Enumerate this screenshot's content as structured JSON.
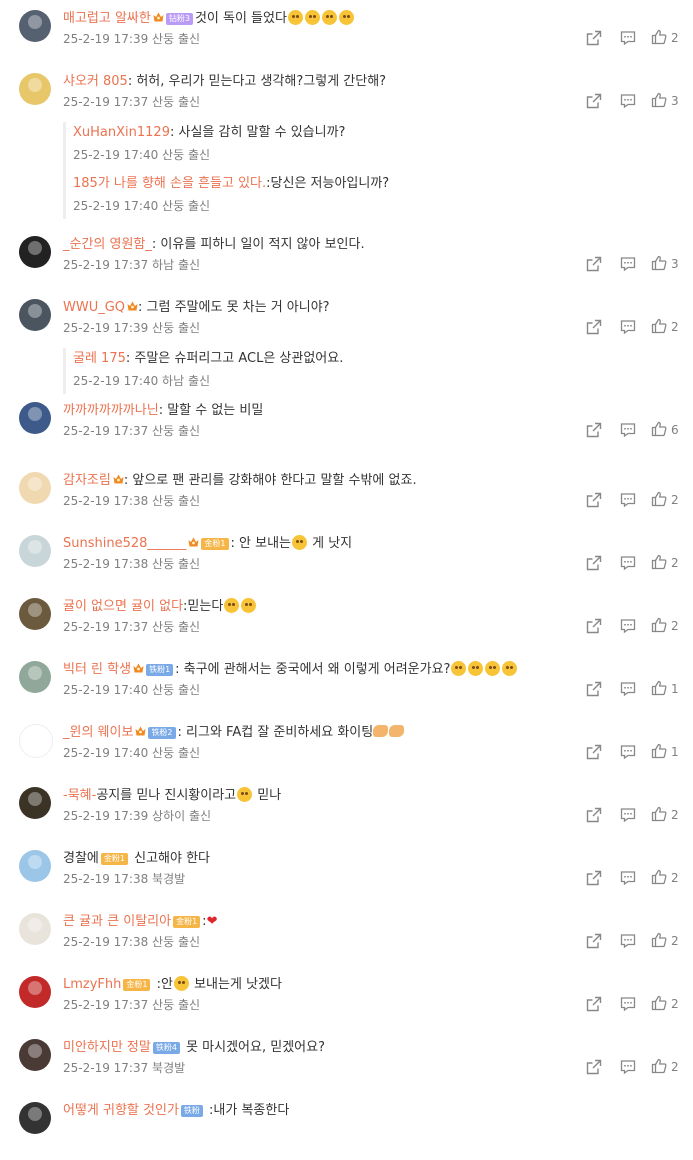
{
  "comments": [
    {
      "name": "매고럽고 알싸한",
      "badge": "钻粉3",
      "badge_color": "#b99bf5",
      "crown": true,
      "text": "것이 독이 들었다",
      "emojis": 4,
      "time": "25-2-19 17:39 산둥 출신",
      "likes": "2",
      "avatar_color": "#556070"
    },
    {
      "name": "샤오커 805",
      "text": ": 허허, 우리가 믿는다고 생각해?그렇게 간단해?",
      "time": "25-2-19 17:37 산둥 출신",
      "likes": "3",
      "avatar_color": "#e8c76a",
      "replies": [
        {
          "name": "XuHanXin1129",
          "text": ": 사실을 감히 말할 수 있습니까?",
          "time": "25-2-19 17:40 산둥 출신"
        },
        {
          "name": "185가 나를 향해 손을 흔들고 있다.",
          "text": ":당신은 저능아입니까?",
          "time": "25-2-19 17:40 산둥 출신"
        }
      ]
    },
    {
      "name": "_순간의 영원함_",
      "text": ": 이유를 피하니 일이 적지 않아 보인다.",
      "time": "25-2-19 17:37 하남 출신",
      "likes": "3",
      "avatar_color": "#222222"
    },
    {
      "name": "WWU_GQ",
      "crown": true,
      "text": ": 그럼 주말에도 못 차는 거 아니야?",
      "time": "25-2-19 17:39 산둥 출신",
      "likes": "2",
      "avatar_color": "#4a5560",
      "replies": [
        {
          "name": "굴레 175",
          "text": ": 주말은 슈퍼리그고 ACL은 상관없어요.",
          "time": "25-2-19 17:40 하남 출신"
        }
      ]
    },
    {
      "name": "까까까까까까나닌",
      "text": ": 말할 수 없는 비밀",
      "time": "25-2-19 17:37 산둥 출신",
      "likes": "6",
      "avatar_color": "#3d5a8a"
    },
    {
      "name": "감자조림",
      "crown": true,
      "text": ": 앞으로 팬 관리를 강화해야 한다고 말할 수밖에 없죠.",
      "time": "25-2-19 17:38 산둥 출신",
      "likes": "2",
      "avatar_color": "#f0d9b0"
    },
    {
      "name": "Sunshine528______",
      "crown": true,
      "badge": "金粉1",
      "badge_color": "#f5b547",
      "text": ": 안 보내는",
      "emojis": 1,
      "text2": " 게 낫지",
      "time": "25-2-19 17:38 산둥 출신",
      "likes": "2",
      "avatar_color": "#c9d6d9"
    },
    {
      "name": "귤이 없으면 귤이 없다",
      "text": ":믿는다",
      "emojis": 2,
      "time": "25-2-19 17:37 산둥 출신",
      "likes": "2",
      "avatar_color": "#6b5a3e"
    },
    {
      "name": "빅터 린 학생",
      "crown": true,
      "badge": "铁粉1",
      "badge_color": "#7aa9e8",
      "text": ": 축구에 관해서는 중국에서 왜 이렇게 어려운가요?",
      "emojis": 4,
      "time": "25-2-19 17:40 산둥 출신",
      "likes": "1",
      "avatar_color": "#8fa89a"
    },
    {
      "name": "_윈의 웨이보",
      "crown": true,
      "badge": "铁粉2",
      "badge_color": "#7aa9e8",
      "text": ": 리그와 FA컵 잘 준비하세요 화이팅",
      "arms": 2,
      "time": "25-2-19 17:40 산둥 출신",
      "likes": "1",
      "avatar_color": "#ffffff"
    },
    {
      "name": "-묵혜-",
      "text": "공지를 믿나 진시황이라고",
      "emojis": 1,
      "text2": " 믿나",
      "time": "25-2-19 17:39 상하이 출신",
      "likes": "2",
      "avatar_color": "#3b3325"
    },
    {
      "name": "경찰에",
      "plain_name": true,
      "badge": "金粉1",
      "badge_color": "#f5b547",
      "text": " 신고해야 한다",
      "time": "25-2-19 17:38 북경발",
      "likes": "2",
      "avatar_color": "#9cc6e8"
    },
    {
      "name": "큰 귤과 큰 이탈리아",
      "badge": "金粉1",
      "badge_color": "#f5b547",
      "text": ":",
      "heart": true,
      "time": "25-2-19 17:38 산둥 출신",
      "likes": "2",
      "avatar_color": "#e8e4dc"
    },
    {
      "name": "LmzyFhh",
      "badge": "金粉1",
      "badge_color": "#f5b547",
      "text": " :안",
      "emojis": 1,
      "text2": " 보내는게 낫겠다",
      "time": "25-2-19 17:37 산둥 출신",
      "likes": "2",
      "avatar_color": "#c22a2a"
    },
    {
      "name": "미안하지만 정말",
      "badge": "铁粉4",
      "badge_color": "#7aa9e8",
      "text": "  못 마시겠어요, 믿겠어요?",
      "time": "25-2-19 17:37 북경발",
      "likes": "2",
      "avatar_color": "#4a3a35"
    },
    {
      "name": "어떻게 귀향할 것인가",
      "badge": "铁粉",
      "badge_color": "#7aa9e8",
      "text": " :내가 복종한다",
      "time": "",
      "likes": "",
      "avatar_color": "#333333"
    }
  ],
  "colors": {
    "name": "#eb7350",
    "meta": "#808080",
    "icon": "#888888"
  }
}
